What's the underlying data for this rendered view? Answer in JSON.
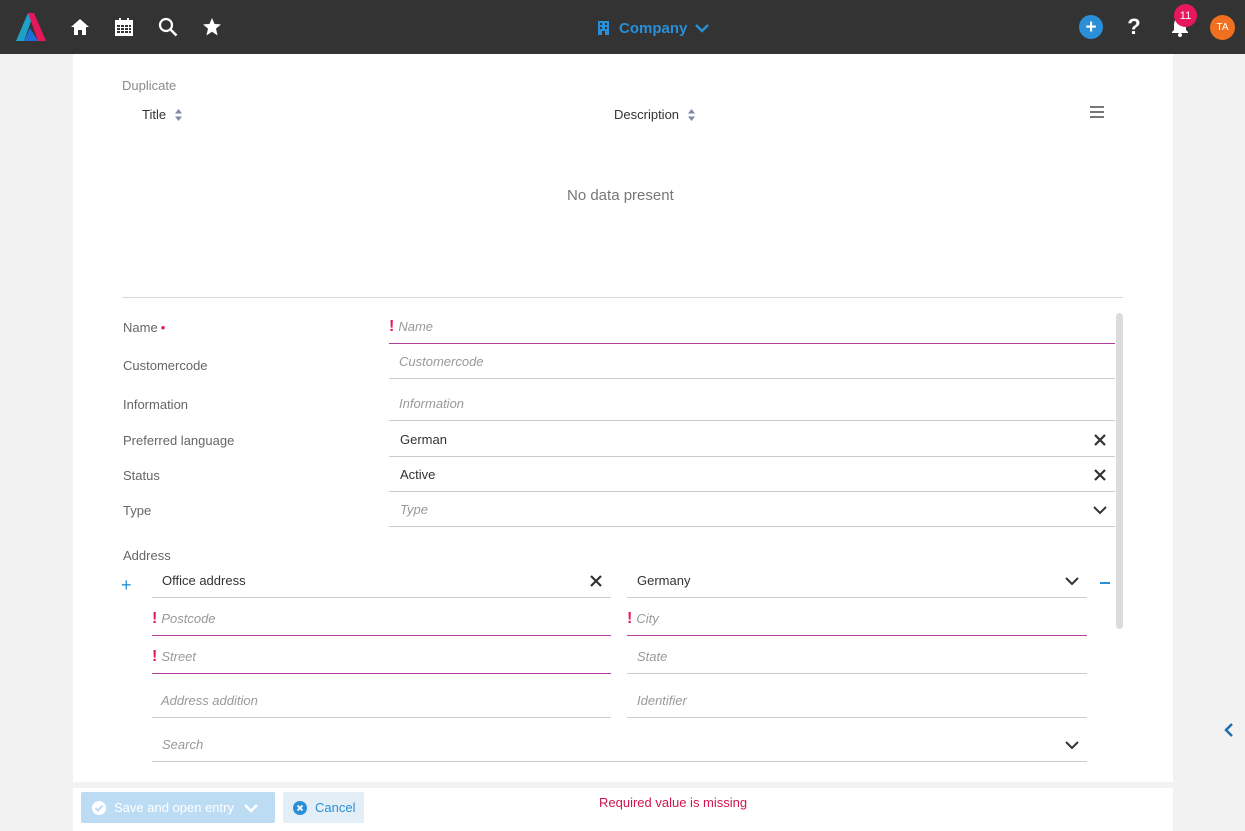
{
  "topbar": {
    "context_title": "Company",
    "notification_count": "11",
    "avatar_initials": "TA",
    "help_label": "?",
    "add_label": "+"
  },
  "duplicate": {
    "section_label": "Duplicate",
    "columns": [
      "Title",
      "Description"
    ],
    "empty_message": "No data present"
  },
  "form": {
    "name": {
      "label": "Name",
      "required_marker": "•",
      "placeholder": "Name"
    },
    "customercode": {
      "label": "Customercode",
      "placeholder": "Customercode"
    },
    "information": {
      "label": "Information",
      "placeholder": "Information"
    },
    "preferred_language": {
      "label": "Preferred language",
      "value": "German"
    },
    "status": {
      "label": "Status",
      "value": "Active"
    },
    "type": {
      "label": "Type",
      "placeholder": "Type"
    }
  },
  "address": {
    "label": "Address",
    "add_symbol": "+",
    "address_type": "Office address",
    "country": "Germany",
    "postcode_placeholder": "Postcode",
    "city_placeholder": "City",
    "street_placeholder": "Street",
    "state_placeholder": "State",
    "addition_placeholder": "Address addition",
    "identifier_placeholder": "Identifier",
    "search_placeholder": "Search"
  },
  "error_marker": "!",
  "footer": {
    "save_label": "Save and open entry",
    "cancel_label": "Cancel",
    "error_message": "Required value is missing"
  },
  "colors": {
    "topbar": "#333333",
    "accent": "#2a8fd6",
    "error": "#e8175d",
    "error_underline": "#b23c9b",
    "avatar": "#f07020"
  }
}
